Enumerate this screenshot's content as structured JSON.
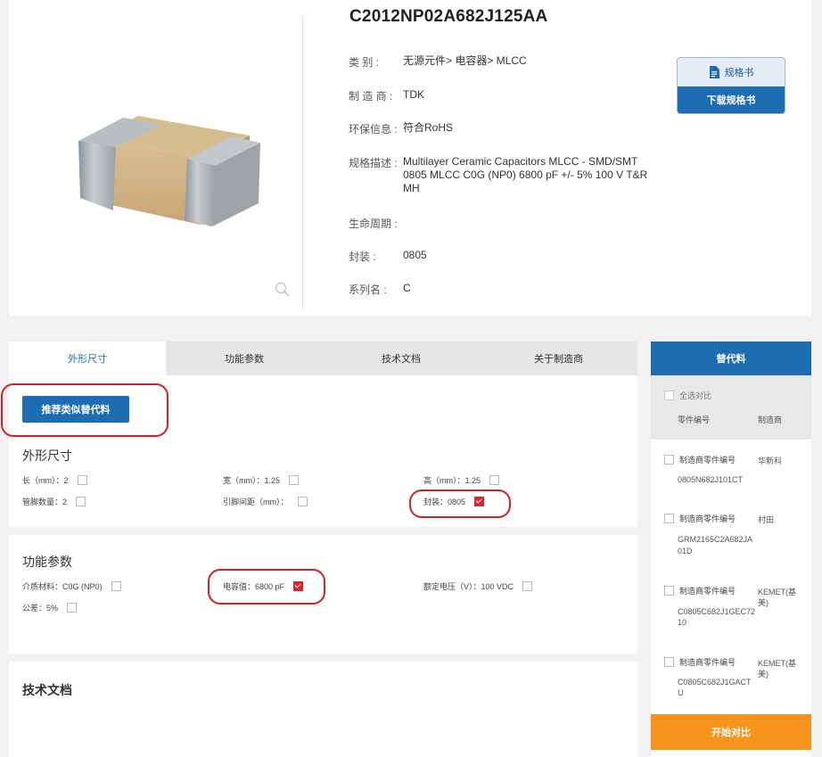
{
  "product": {
    "part_number": "C2012NP02A682J125AA",
    "category_label": "类 别 :",
    "category_value": "无源元件> 电容器> MLCC",
    "manufacturer_label": "制 造 商 :",
    "manufacturer_value": "TDK",
    "env_label": "环保信息 :",
    "env_value": "符合RoHS",
    "spec_label": "规格描述 :",
    "spec_value": "Multilayer Ceramic Capacitors MLCC - SMD/SMT 0805 MLCC C0G (NP0) 6800 pF +/- 5% 100 V T&R MH",
    "lifecycle_label": "生命周期 :",
    "lifecycle_value": "",
    "package_label": "封装 :",
    "package_value": "0805",
    "series_label": "系列名 :",
    "series_value": "C",
    "datasheet_top": "规格书",
    "datasheet_bottom": "下载规格书",
    "zoom_icon": "magnifier-icon"
  },
  "tabs": [
    {
      "label": "外形尺寸",
      "active": true
    },
    {
      "label": "功能参数",
      "active": false
    },
    {
      "label": "技术文档",
      "active": false
    },
    {
      "label": "关于制造商",
      "active": false
    }
  ],
  "dimensions": {
    "recommend_button": "推荐类似替代料",
    "title": "外形尺寸",
    "length": "长（mm）：2",
    "width": "宽（mm）：1.25",
    "height": "高（mm）：1.25",
    "pin_count": "管脚数量：2",
    "pin_pitch": "引脚间距（mm）：",
    "package": "封装：0805"
  },
  "function": {
    "title": "功能参数",
    "dielectric": "介质材料：C0G (NP0)",
    "capacitance": "电容值：6800 pF",
    "voltage": "额定电压（V）：100 VDC",
    "tolerance": "公差：5%"
  },
  "docs": {
    "title": "技术文档"
  },
  "alternatives": {
    "header": "替代料",
    "select_all": "全选对比",
    "col_part": "零件编号",
    "col_mfr": "制造商",
    "item_label": "制造商零件编号",
    "items": [
      {
        "part_line1": "0805N682J101CT",
        "part_line2": "",
        "mfr_line1": "华新科",
        "mfr_line2": ""
      },
      {
        "part_line1": "GRM2165C2A682JA",
        "part_line2": "01D",
        "mfr_line1": "村田",
        "mfr_line2": ""
      },
      {
        "part_line1": "C0805C682J1GEC72",
        "part_line2": "10",
        "mfr_line1": "KEMET(基",
        "mfr_line2": "美)"
      },
      {
        "part_line1": "C0805C682J1GACT",
        "part_line2": "U",
        "mfr_line1": "KEMET(基",
        "mfr_line2": "美)"
      }
    ],
    "compare_button": "开始对比"
  },
  "colors": {
    "primary": "#1e6db3",
    "highlight_red": "#d41f26",
    "compare_orange": "#f7941d"
  }
}
